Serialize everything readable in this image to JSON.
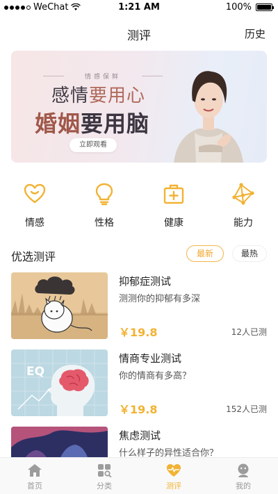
{
  "status_bar": {
    "carrier": "WeChat",
    "time": "1:21 AM",
    "battery": "100%",
    "battery_level": 1.0
  },
  "nav": {
    "title": "测评",
    "history": "历史"
  },
  "banner": {
    "tag": "情感保鲜",
    "line1_a": "感情",
    "line1_b": "要用心",
    "line2_a": "婚姻",
    "line2_b": "要用脑",
    "button": "立即观看"
  },
  "categories": [
    {
      "label": "情感",
      "icon": "heart-smile-icon"
    },
    {
      "label": "性格",
      "icon": "lightbulb-icon"
    },
    {
      "label": "健康",
      "icon": "medical-kit-icon"
    },
    {
      "label": "能力",
      "icon": "network-icon"
    }
  ],
  "section": {
    "title": "优选测评",
    "filter_new": "最新",
    "filter_hot": "最热"
  },
  "tests": [
    {
      "title": "抑郁症测试",
      "subtitle": "测测你的抑郁有多深",
      "price": "￥19.8",
      "count": "12人已测"
    },
    {
      "title": "情商专业测试",
      "subtitle": "你的情商有多高？",
      "price": "￥19.8",
      "count": "152人已测",
      "thumb_text": "EQ"
    },
    {
      "title": "焦虑测试",
      "subtitle": "什么样子的异性适合你？"
    }
  ],
  "tab_bar": [
    {
      "label": "首页",
      "icon": "home-icon"
    },
    {
      "label": "分类",
      "icon": "grid-icon"
    },
    {
      "label": "测评",
      "icon": "heartbeat-icon",
      "active": true
    },
    {
      "label": "我的",
      "icon": "profile-icon"
    }
  ],
  "colors": {
    "accent": "#f2b233",
    "text": "#222222",
    "muted": "#999999"
  }
}
